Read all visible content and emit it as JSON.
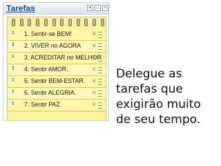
{
  "gadget": {
    "title": "Tarefas",
    "buttons": {
      "settings_icon": "gear-icon",
      "minimize_icon": "minimize-icon",
      "close_icon": "close-icon"
    }
  },
  "tasks": [
    {
      "label": "1. Sentir-se BEM!"
    },
    {
      "label": "2.  VIVER no AGORA"
    },
    {
      "label": "3.  ACREDITAR no MELHOR"
    },
    {
      "label": "4.  Sentir AMOR."
    },
    {
      "label": "5.  Sentir BEM-ESTAR."
    },
    {
      "label": "6.  Sentir ALEGRIA."
    },
    {
      "label": "7.  Sentir PAZ."
    }
  ],
  "caption": {
    "lines": [
      "Delegue as",
      "tarefas que",
      "exigirão muito",
      "de seu tempo."
    ]
  },
  "colors": {
    "note_background": "#fbf39e",
    "title_text": "#1f4f8f"
  }
}
